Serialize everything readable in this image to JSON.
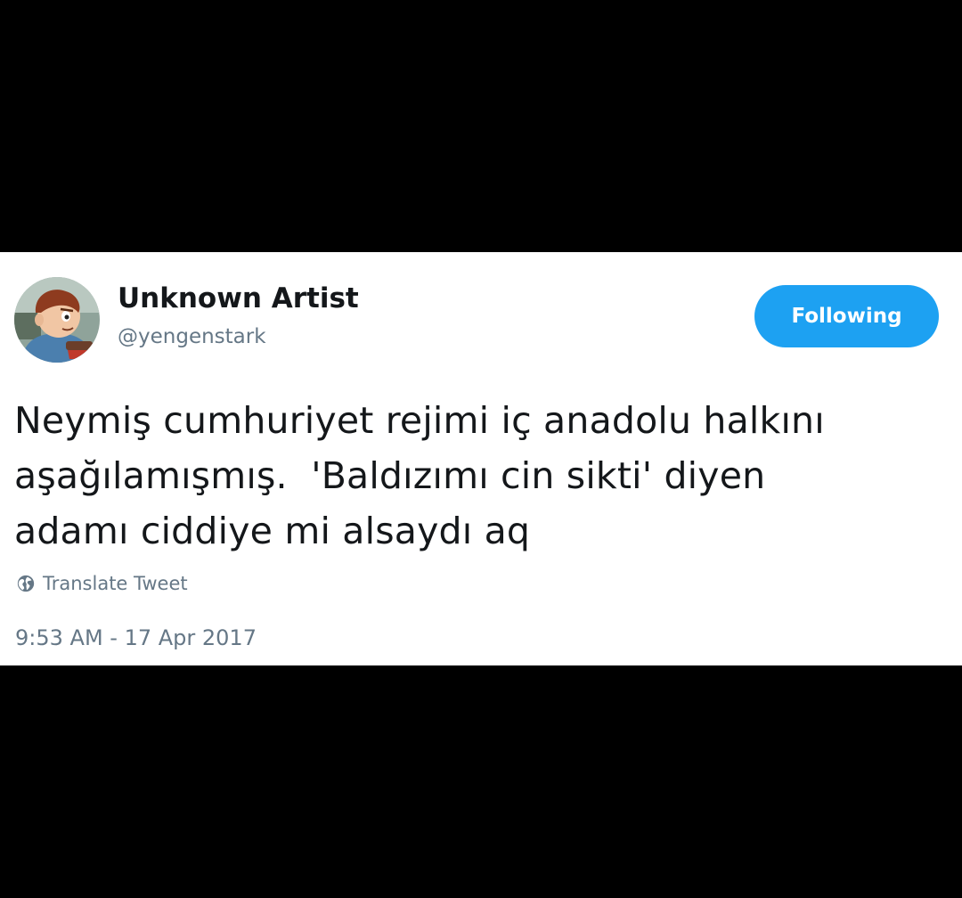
{
  "tweet": {
    "author": {
      "display_name": "Unknown Artist",
      "handle": "@yengenstark",
      "avatar_icon": "cartoon-avatar"
    },
    "follow_button": {
      "label": "Following",
      "color": "#1da1f2"
    },
    "text_lines": [
      "Neymiş cumhuriyet rejimi iç anadolu halkını",
      "aşağılamışmış.  'Baldızımı cin sikti' diyen",
      "adamı ciddiye mi alsaydı aq"
    ],
    "translate": {
      "icon": "globe-icon",
      "label": "Translate Tweet"
    },
    "timestamp": "9:53 AM - 17 Apr 2017"
  },
  "colors": {
    "background": "#000000",
    "card": "#ffffff",
    "primary_text": "#14171a",
    "secondary_text": "#657786",
    "accent": "#1da1f2"
  }
}
